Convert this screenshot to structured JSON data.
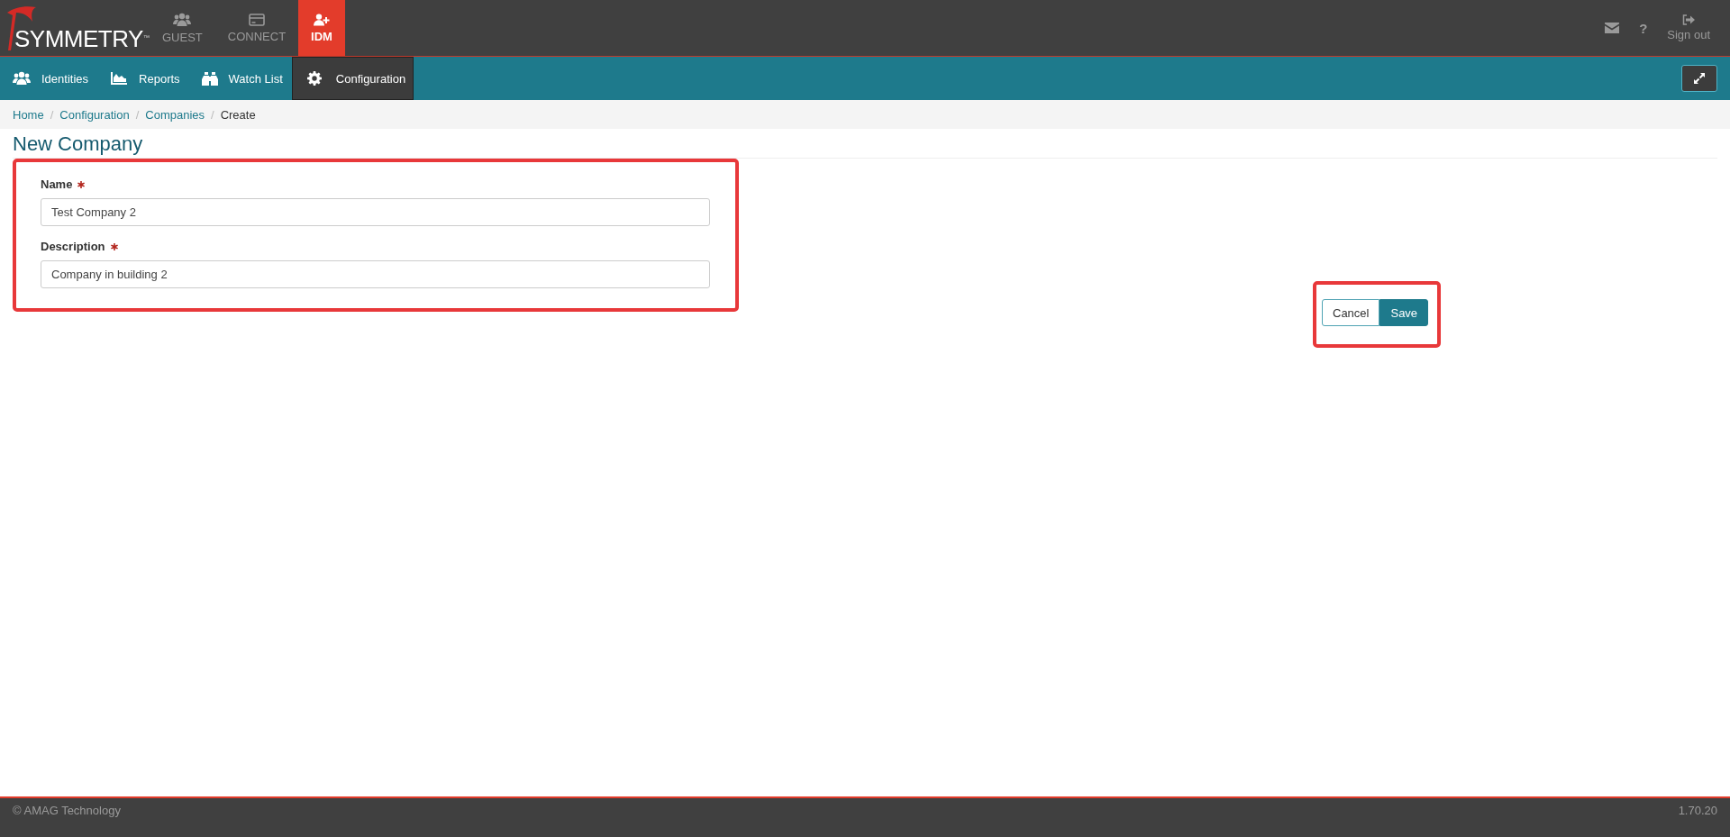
{
  "brand": {
    "logo_text": "SYMMETRY",
    "trademark": "™"
  },
  "apps": [
    {
      "label": "GUEST",
      "kind": "users",
      "selected": false
    },
    {
      "label": "CONNECT",
      "kind": "card",
      "selected": false
    },
    {
      "label": "IDM",
      "kind": "user-plus",
      "selected": true
    }
  ],
  "header_actions": [
    {
      "kind": "mail"
    },
    {
      "kind": "help",
      "label": "?"
    },
    {
      "kind": "signout",
      "label": "Sign out"
    }
  ],
  "nav": [
    {
      "label": "Identities",
      "kind": "users",
      "selected": false
    },
    {
      "label": "Reports",
      "kind": "chart",
      "selected": false
    },
    {
      "label": "Watch List",
      "kind": "binoculars",
      "selected": false
    },
    {
      "label": "Configuration",
      "kind": "gear",
      "selected": true
    }
  ],
  "breadcrumb": [
    {
      "label": "Home",
      "current": false,
      "separator": "/"
    },
    {
      "label": "Configuration",
      "current": false,
      "separator": "/"
    },
    {
      "label": "Companies",
      "current": false,
      "separator": "/"
    },
    {
      "label": "Create",
      "current": true
    }
  ],
  "page_title": "New Company",
  "form": {
    "highlighted": true,
    "fields": [
      {
        "label": "Name",
        "required": true,
        "value": "Test Company 2"
      },
      {
        "label": "Description",
        "required": true,
        "value": "Company in building 2"
      }
    ]
  },
  "actions": {
    "highlighted": true,
    "buttons": [
      {
        "label": "Cancel",
        "kind": "secondary"
      },
      {
        "label": "Save",
        "kind": "primary"
      }
    ]
  },
  "footer": {
    "copyright": "© AMAG Technology",
    "version": "1.70.20"
  }
}
